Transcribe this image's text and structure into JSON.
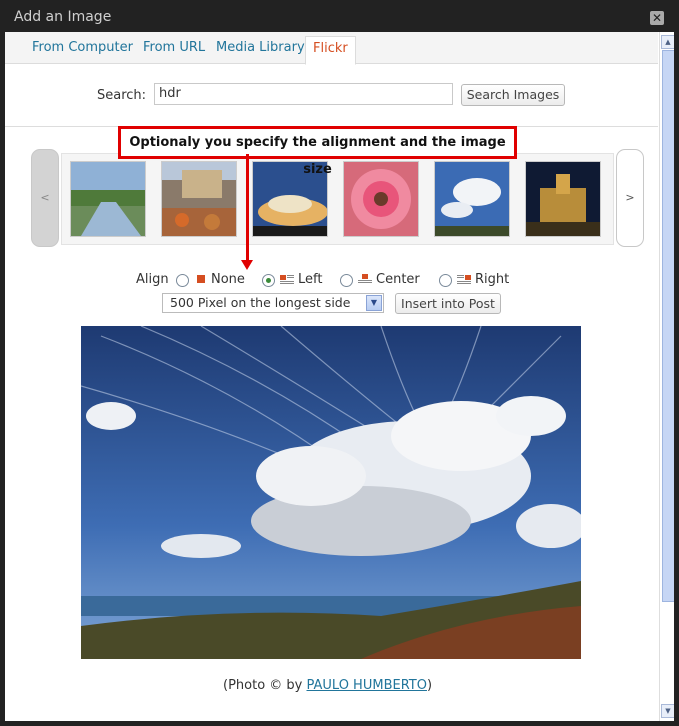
{
  "dialog": {
    "title": "Add an Image",
    "close_label": "✕"
  },
  "tabs": [
    {
      "label": "From Computer",
      "active": false
    },
    {
      "label": "From URL",
      "active": false
    },
    {
      "label": "Media Library",
      "active": false
    },
    {
      "label": "Flickr",
      "active": true
    }
  ],
  "search": {
    "label": "Search:",
    "value": "hdr",
    "button_label": "Search Images"
  },
  "gallery": {
    "prev_label": "<",
    "next_label": ">",
    "thumbnail_count": 6
  },
  "annotation": {
    "text": "Optionaly you specify the alignment and the image size",
    "color": "#e00000"
  },
  "align": {
    "label": "Align",
    "options": [
      {
        "label": "None",
        "checked": false
      },
      {
        "label": "Left",
        "checked": true
      },
      {
        "label": "Center",
        "checked": false
      },
      {
        "label": "Right",
        "checked": false
      }
    ]
  },
  "size": {
    "selected": "500 Pixel on the longest side"
  },
  "insert_button": "Insert into Post",
  "credit": {
    "prefix": "(Photo © by ",
    "author": "PAULO HUMBERTO",
    "suffix": ")"
  },
  "colors": {
    "accent": "#21759b",
    "active_tab": "#d54e21"
  }
}
